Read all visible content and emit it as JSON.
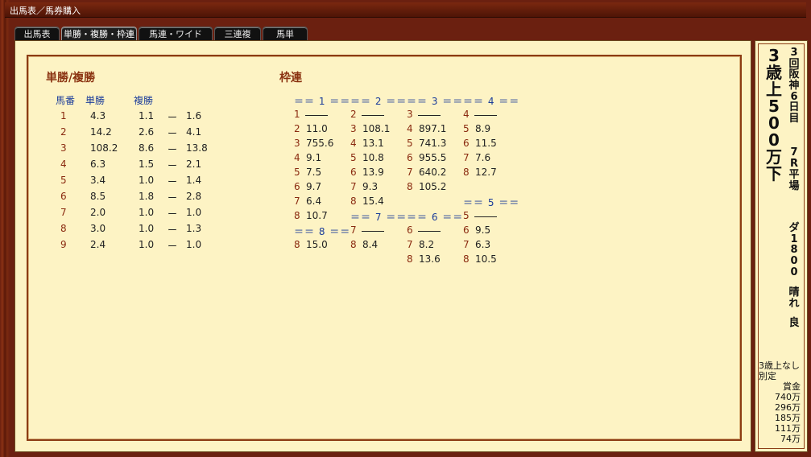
{
  "window": {
    "title": "出馬表／馬券購入"
  },
  "tabs": [
    {
      "label": "出馬表",
      "active": false
    },
    {
      "label": "単勝・複勝・枠連",
      "active": true
    },
    {
      "label": "馬連・ワイド",
      "active": false
    },
    {
      "label": "三連複",
      "active": false
    },
    {
      "label": "馬単",
      "active": false
    }
  ],
  "win_place": {
    "title": "単勝/複勝",
    "headers": {
      "num": "馬番",
      "win": "単勝",
      "place": "複勝"
    },
    "rows": [
      {
        "num": "1",
        "win": "4.3",
        "place_lo": "1.1",
        "place_hi": "1.6"
      },
      {
        "num": "2",
        "win": "14.2",
        "place_lo": "2.6",
        "place_hi": "4.1"
      },
      {
        "num": "3",
        "win": "108.2",
        "place_lo": "8.6",
        "place_hi": "13.8"
      },
      {
        "num": "4",
        "win": "6.3",
        "place_lo": "1.5",
        "place_hi": "2.1"
      },
      {
        "num": "5",
        "win": "3.4",
        "place_lo": "1.0",
        "place_hi": "1.4"
      },
      {
        "num": "6",
        "win": "8.5",
        "place_lo": "1.8",
        "place_hi": "2.8"
      },
      {
        "num": "7",
        "win": "2.0",
        "place_lo": "1.0",
        "place_hi": "1.0"
      },
      {
        "num": "8",
        "win": "3.0",
        "place_lo": "1.0",
        "place_hi": "1.3"
      },
      {
        "num": "9",
        "win": "2.4",
        "place_lo": "1.0",
        "place_hi": "1.0"
      }
    ],
    "sep": "ー"
  },
  "bracket": {
    "title": "枠連",
    "groups": [
      {
        "header": "＝＝ 1 ＝＝",
        "rows": [
          {
            "n": "1",
            "v": ""
          },
          {
            "n": "2",
            "v": "11.0"
          },
          {
            "n": "3",
            "v": "755.6"
          },
          {
            "n": "4",
            "v": "9.1"
          },
          {
            "n": "5",
            "v": "7.5"
          },
          {
            "n": "6",
            "v": "9.7"
          },
          {
            "n": "7",
            "v": "6.4"
          },
          {
            "n": "8",
            "v": "10.7"
          }
        ]
      },
      {
        "header": "＝＝ 2 ＝＝",
        "rows": [
          {
            "n": "2",
            "v": ""
          },
          {
            "n": "3",
            "v": "108.1"
          },
          {
            "n": "4",
            "v": "13.1"
          },
          {
            "n": "5",
            "v": "10.8"
          },
          {
            "n": "6",
            "v": "13.9"
          },
          {
            "n": "7",
            "v": "9.3"
          },
          {
            "n": "8",
            "v": "15.4"
          }
        ]
      },
      {
        "header": "＝＝ 3 ＝＝",
        "rows": [
          {
            "n": "3",
            "v": ""
          },
          {
            "n": "4",
            "v": "897.1"
          },
          {
            "n": "5",
            "v": "741.3"
          },
          {
            "n": "6",
            "v": "955.5"
          },
          {
            "n": "7",
            "v": "640.2"
          },
          {
            "n": "8",
            "v": "105.2"
          }
        ]
      },
      {
        "header": "＝＝ 4 ＝＝",
        "rows": [
          {
            "n": "4",
            "v": ""
          },
          {
            "n": "5",
            "v": "8.9"
          },
          {
            "n": "6",
            "v": "11.5"
          },
          {
            "n": "7",
            "v": "7.6"
          },
          {
            "n": "8",
            "v": "12.7"
          }
        ]
      },
      {
        "header": "＝＝ 5 ＝＝",
        "rows": [
          {
            "n": "5",
            "v": ""
          },
          {
            "n": "6",
            "v": "9.5"
          },
          {
            "n": "7",
            "v": "6.3"
          },
          {
            "n": "8",
            "v": "10.5"
          }
        ]
      },
      {
        "header": "＝＝ 6 ＝＝",
        "rows": [
          {
            "n": "6",
            "v": ""
          },
          {
            "n": "7",
            "v": "8.2"
          },
          {
            "n": "8",
            "v": "13.6"
          }
        ]
      },
      {
        "header": "＝＝ 7 ＝＝",
        "rows": [
          {
            "n": "7",
            "v": ""
          },
          {
            "n": "8",
            "v": "8.4"
          }
        ]
      },
      {
        "header": "＝＝ 8 ＝＝",
        "rows": [
          {
            "n": "8",
            "v": "15.0"
          }
        ]
      }
    ]
  },
  "race_info": {
    "race_name": "3歳上500万下",
    "meeting": "3回阪神6日目",
    "race_no": "7R",
    "venue_type": "平場",
    "course": "ダ1800",
    "weather": "晴れ",
    "track": "良",
    "conditions": "3歳上なし",
    "weight_rule": "別定",
    "prize_label": "賞金",
    "prizes": [
      "740万",
      "296万",
      "185万",
      "111万",
      "74万"
    ]
  },
  "colors": {
    "panel_bg": "#fdf3c4",
    "title_brown": "#8a3210",
    "header_blue": "#1b3c9a",
    "number_red": "#8a2a10"
  }
}
